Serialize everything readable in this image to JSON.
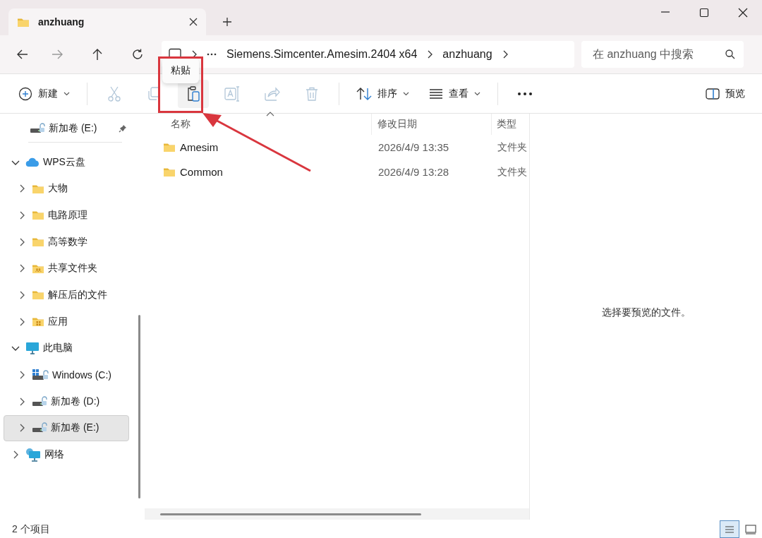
{
  "window": {
    "tab_title": "anzhuang"
  },
  "address_bar": {
    "segments": [
      "Siemens.Simcenter.Amesim.2404 x64",
      "anzhuang"
    ]
  },
  "search": {
    "placeholder": "在 anzhuang 中搜索"
  },
  "tooltip": "粘贴",
  "toolbar": {
    "items": [
      {
        "kind": "new",
        "label": "新建"
      },
      {
        "kind": "separator"
      },
      {
        "kind": "cut",
        "disabled": true
      },
      {
        "kind": "copy",
        "disabled": true
      },
      {
        "kind": "paste",
        "disabled": false
      },
      {
        "kind": "rename",
        "disabled": true
      },
      {
        "kind": "share",
        "disabled": true
      },
      {
        "kind": "delete",
        "disabled": true
      },
      {
        "kind": "separator"
      },
      {
        "kind": "sort",
        "label": "排序"
      },
      {
        "kind": "view",
        "label": "查看"
      },
      {
        "kind": "separator"
      },
      {
        "kind": "more"
      }
    ],
    "preview": {
      "label": "预览"
    }
  },
  "sidebar": {
    "pinned": [
      {
        "label": "新加卷 (E:)",
        "kind": "drive",
        "selected": false
      }
    ],
    "tree": [
      {
        "label": "WPS云盘",
        "kind": "cloud",
        "expanded": true,
        "selected": false,
        "children": [
          {
            "label": "大物",
            "kind": "folder",
            "expanded": false,
            "selected": false
          },
          {
            "label": "电路原理",
            "kind": "folder",
            "expanded": false,
            "selected": false
          },
          {
            "label": "高等数学",
            "kind": "folder",
            "expanded": false,
            "selected": false
          },
          {
            "label": "共享文件夹",
            "kind": "shared",
            "expanded": false,
            "selected": false
          },
          {
            "label": "解压后的文件",
            "kind": "folder",
            "expanded": false,
            "selected": false
          },
          {
            "label": "应用",
            "kind": "app",
            "expanded": false,
            "selected": false
          }
        ]
      },
      {
        "label": "此电脑",
        "kind": "pc",
        "expanded": true,
        "selected": false,
        "children": [
          {
            "label": "Windows (C:)",
            "kind": "windrive",
            "expanded": false,
            "selected": false
          },
          {
            "label": "新加卷 (D:)",
            "kind": "drive",
            "expanded": false,
            "selected": false
          },
          {
            "label": "新加卷 (E:)",
            "kind": "drive",
            "expanded": false,
            "selected": true
          }
        ]
      },
      {
        "label": "网络",
        "kind": "network",
        "expanded": false,
        "selected": false
      }
    ]
  },
  "file_list": {
    "columns": [
      {
        "label": "名称",
        "sorted": true
      },
      {
        "label": "修改日期",
        "sorted": false
      },
      {
        "label": "类型",
        "sorted": false
      }
    ],
    "rows": [
      {
        "name": "Amesim",
        "modified": "2026/4/9 13:35",
        "type": "文件夹",
        "selected": false
      },
      {
        "name": "Common",
        "modified": "2026/4/9 13:28",
        "type": "文件夹",
        "selected": false
      }
    ]
  },
  "preview_pane": {
    "message": "选择要预览的文件。"
  },
  "status_bar": {
    "count": "2 个项目",
    "views": [
      {
        "kind": "details",
        "selected": true
      },
      {
        "kind": "tiles",
        "selected": false
      }
    ]
  }
}
